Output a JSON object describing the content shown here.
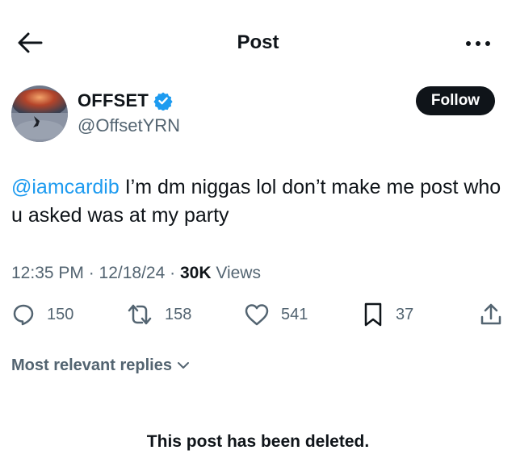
{
  "header": {
    "title": "Post"
  },
  "author": {
    "name": "OFFSET",
    "handle": "@OffsetYRN",
    "verified": true
  },
  "follow_button": {
    "label": "Follow"
  },
  "tweet": {
    "mention": "@iamcardib",
    "body": " I’m dm niggas lol don’t make me post who u asked was at my party"
  },
  "meta": {
    "time_date": "12:35 PM · 12/18/24 · ",
    "views_count": "30K",
    "views_label": " Views"
  },
  "actions": {
    "replies": "150",
    "reposts": "158",
    "likes": "541",
    "bookmarks": "37"
  },
  "replies_sort": {
    "label": "Most relevant replies"
  },
  "notice": {
    "text": "This post has been deleted."
  },
  "colors": {
    "link": "#1d9bf0",
    "secondary_text": "#536471",
    "primary": "#0f1419"
  },
  "icons": [
    "back-arrow-icon",
    "more-icon",
    "verified-badge-icon",
    "reply-icon",
    "repost-icon",
    "like-icon",
    "bookmark-icon",
    "share-icon",
    "chevron-down-icon"
  ]
}
